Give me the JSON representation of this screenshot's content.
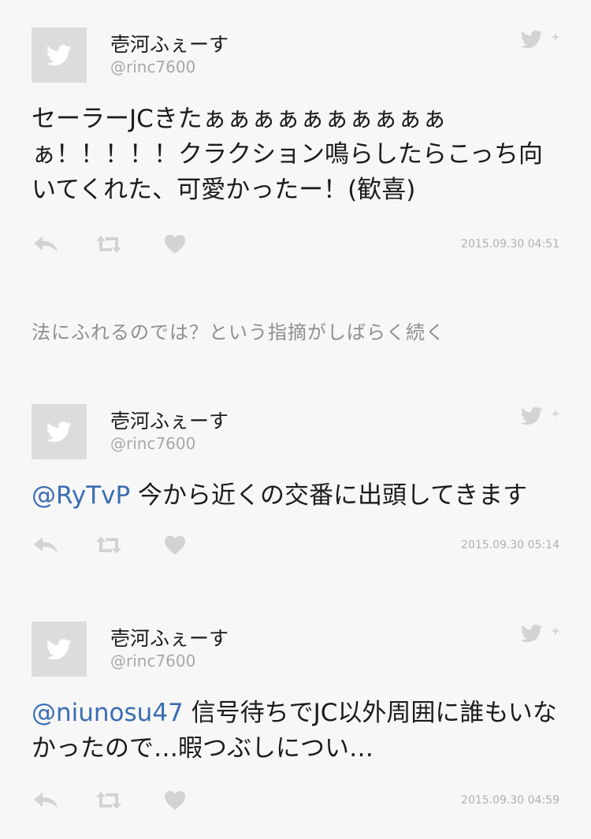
{
  "colors": {
    "background": "#f7f7f7",
    "mention": "#3a6db3",
    "icon_gray": "#d3d3d3",
    "text": "#1b1b1b",
    "subtle_text": "#a8a8a8"
  },
  "icons": {
    "follow": "twitter-bird-plus-icon",
    "reply": "reply-icon",
    "retweet": "retweet-icon",
    "like": "heart-icon",
    "avatar": "twitter-egg-avatar-icon"
  },
  "tweets": [
    {
      "name": "壱河ふぇーす",
      "handle": "@rinc7600",
      "mention": "",
      "text": "セーラーJCきたぁぁぁぁぁぁぁぁぁぁぁ！！！！！クラクション鳴らしたらこっち向いてくれた、可愛かったー！(歓喜)",
      "timestamp": "2015.09.30 04:51"
    },
    {
      "name": "壱河ふぇーす",
      "handle": "@rinc7600",
      "mention": "@RyTvP",
      "text": " 今から近くの交番に出頭してきます",
      "timestamp": "2015.09.30 05:14"
    },
    {
      "name": "壱河ふぇーす",
      "handle": "@rinc7600",
      "mention": "@niunosu47",
      "text": " 信号待ちでJC以外周囲に誰もいなかったので…暇つぶしについ…",
      "timestamp": "2015.09.30 04:59"
    }
  ],
  "narration": "法にふれるのでは？という指摘がしばらく続く"
}
